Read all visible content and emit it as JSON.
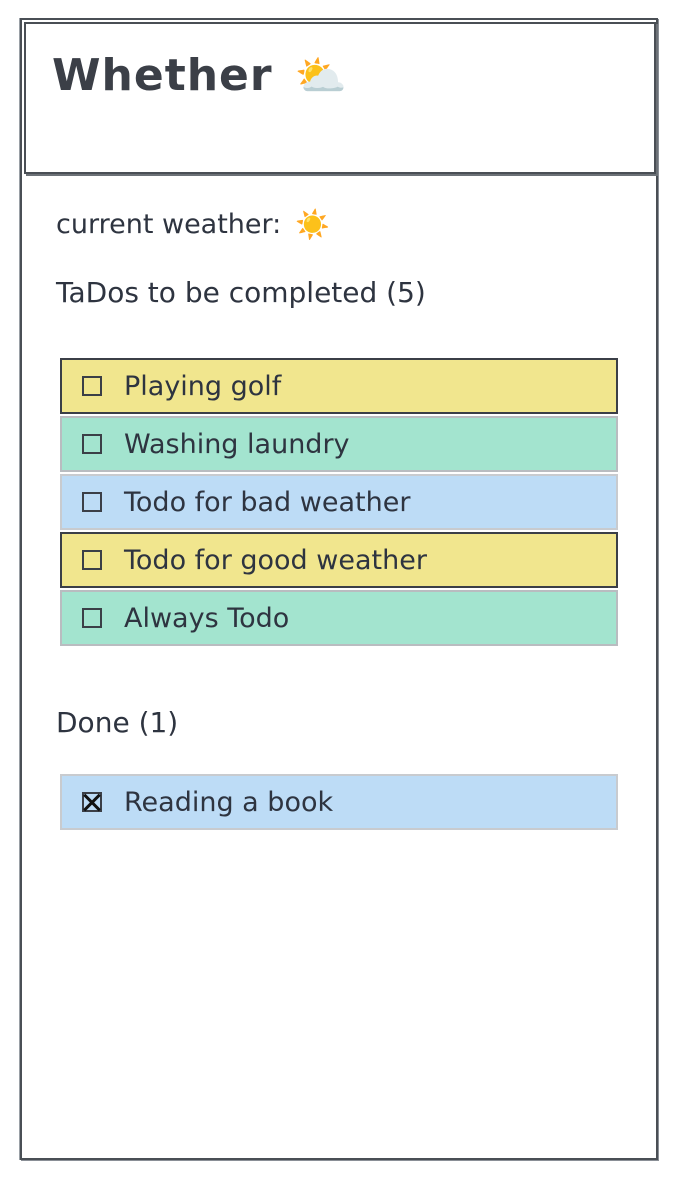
{
  "app": {
    "title": "Whether",
    "title_icon": "sun-behind-cloud-icon",
    "title_icon_glyph": "⛅"
  },
  "weather": {
    "label": "current weather:",
    "icon": "sun-icon",
    "icon_glyph": "☀️"
  },
  "todo_section": {
    "heading": "TaDos to be completed (5)",
    "items": [
      {
        "label": "Playing golf",
        "checked": false,
        "color": "#f1e68e"
      },
      {
        "label": "Washing laundry",
        "checked": false,
        "color": "#a3e4cf"
      },
      {
        "label": "Todo for bad weather",
        "checked": false,
        "color": "#bddcf6"
      },
      {
        "label": "Todo for good weather",
        "checked": false,
        "color": "#f1e68e"
      },
      {
        "label": "Always Todo",
        "checked": false,
        "color": "#a3e4cf"
      }
    ]
  },
  "done_section": {
    "heading": "Done (1)",
    "items": [
      {
        "label": "Reading a book",
        "checked": true,
        "color": "#bddcf6"
      }
    ]
  }
}
